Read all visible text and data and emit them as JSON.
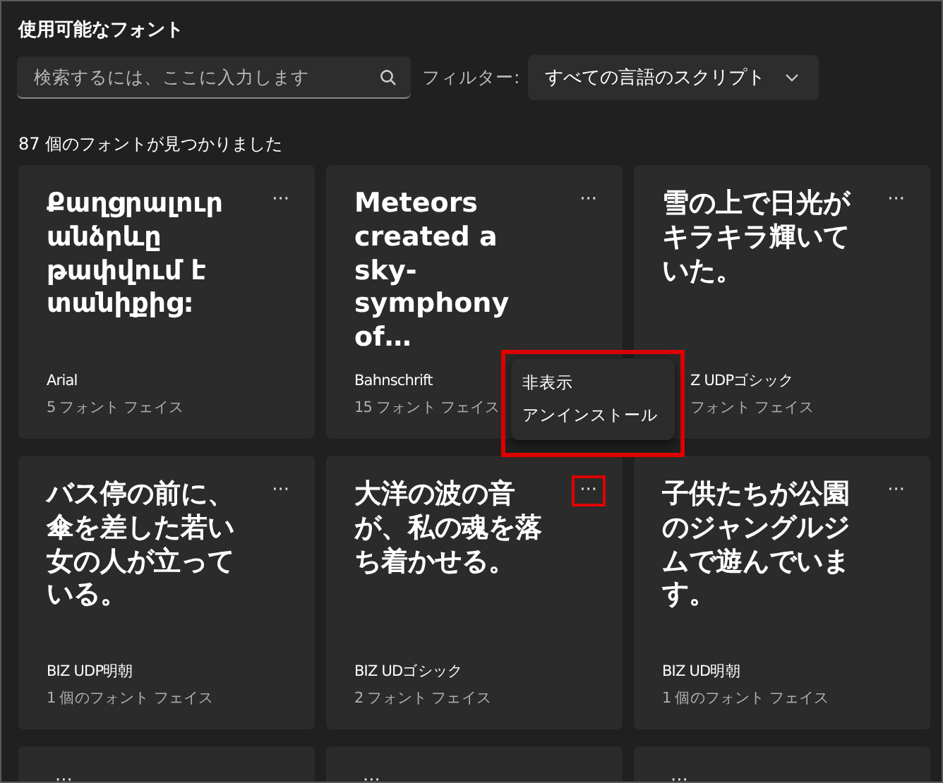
{
  "title": "使用可能なフォント",
  "search": {
    "placeholder": "検索するには、ここに入力します"
  },
  "filter": {
    "label": "フィルター:",
    "value": "すべての言語のスクリプト"
  },
  "count": "87 個のフォントが見つかりました",
  "cards": [
    {
      "sample": "Քաղցրալուր անձրևը թափվում է տանիքից:",
      "name": "Arial",
      "faces": "5 フォント フェイス",
      "more": "···",
      "highlighted": false,
      "covered": false
    },
    {
      "sample": "Meteors created a sky-symphony of…",
      "name": "Bahnschrift",
      "faces": "15 フォント フェイス",
      "more": "···",
      "highlighted": false,
      "covered": false
    },
    {
      "sample": "雪の上で日光がキラキラ輝いていた。",
      "name": "Z UDPゴシック",
      "faces": "フォント フェイス",
      "more": "···",
      "highlighted": false,
      "covered": true
    },
    {
      "sample": "バス停の前に、傘を差した若い女の人が立っている。",
      "name": "BIZ UDP明朝",
      "faces": "1 個のフォント フェイス",
      "more": "···",
      "highlighted": false,
      "covered": false
    },
    {
      "sample": "大洋の波の音が、私の魂を落ち着かせる。",
      "name": "BIZ UDゴシック",
      "faces": "2 フォント フェイス",
      "more": "···",
      "highlighted": true,
      "covered": false
    },
    {
      "sample": "子供たちが公園のジャングルジムで遊んでいます。",
      "name": "BIZ UD明朝",
      "faces": "1 個のフォント フェイス",
      "more": "···",
      "highlighted": false,
      "covered": false
    },
    {
      "more": "···",
      "highlighted": false
    },
    {
      "more": "···",
      "highlighted": false
    },
    {
      "more": "···",
      "highlighted": false
    }
  ],
  "context_menu": {
    "highlighted": true,
    "items": [
      "非表示",
      "アンインストール"
    ]
  }
}
